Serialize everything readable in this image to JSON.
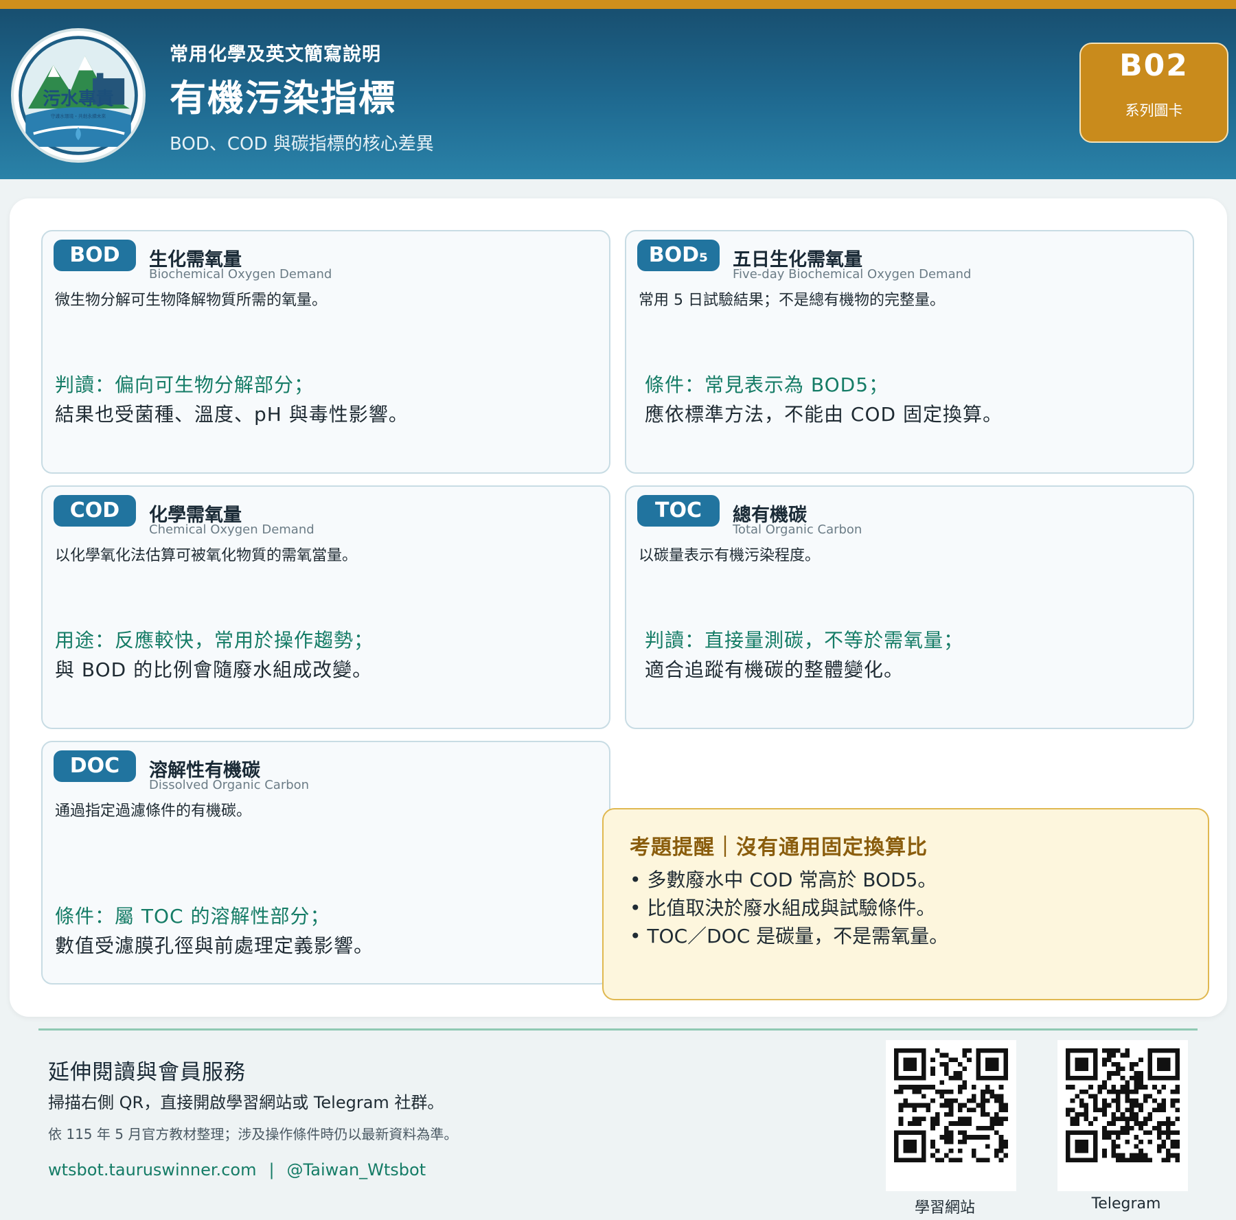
{
  "header": {
    "logo_text": "污水專責",
    "logo_motto": "守護水環境・共創永續未來",
    "kicker": "常用化學及英文簡寫說明",
    "title": "有機污染指標",
    "subtitle": "BOD、COD 與碳指標的核心差異",
    "badge_code": "B02",
    "badge_label": "系列圖卡"
  },
  "cards": [
    {
      "abbr": "BOD",
      "cn": "生化需氧量",
      "en": "Biochemical Oxygen Demand",
      "desc": "微生物分解可生物降解物質所需的氧量。",
      "line1": "判讀：偏向可生物分解部分；",
      "line2": "結果也受菌種、溫度、pH 與毒性影響。"
    },
    {
      "abbr": "BOD₅",
      "cn": "五日生化需氧量",
      "en": "Five-day Biochemical Oxygen Demand",
      "desc": "常用 5 日試驗結果；不是總有機物的完整量。",
      "line1": "條件：常見表示為 BOD5；",
      "line2": "應依標準方法，不能由 COD 固定換算。"
    },
    {
      "abbr": "COD",
      "cn": "化學需氧量",
      "en": "Chemical Oxygen Demand",
      "desc": "以化學氧化法估算可被氧化物質的需氧當量。",
      "line1": "用途：反應較快，常用於操作趨勢；",
      "line2": "與 BOD 的比例會隨廢水組成改變。"
    },
    {
      "abbr": "TOC",
      "cn": "總有機碳",
      "en": "Total Organic Carbon",
      "desc": "以碳量表示有機污染程度。",
      "line1": "判讀：直接量測碳，不等於需氧量；",
      "line2": "適合追蹤有機碳的整體變化。"
    },
    {
      "abbr": "DOC",
      "cn": "溶解性有機碳",
      "en": "Dissolved Organic Carbon",
      "desc": "通過指定過濾條件的有機碳。",
      "line1": "條件：屬 TOC 的溶解性部分；",
      "line2": "數值受濾膜孔徑與前處理定義影響。"
    }
  ],
  "tip": {
    "title": "考題提醒｜沒有通用固定換算比",
    "items": [
      "多數廢水中 COD 常高於 BOD5。",
      "比值取決於廢水組成與試驗條件。",
      "TOC／DOC 是碳量，不是需氧量。"
    ]
  },
  "footer": {
    "title": "延伸閱讀與會員服務",
    "text": "掃描右側 QR，直接開啟學習網站或 Telegram 社群。",
    "note": "依 115 年 5 月官方教材整理；涉及操作條件時仍以最新資料為準。",
    "website": "wtsbot.tauruswinner.com",
    "separator": "|",
    "telegram": "@Taiwan_Wtsbot",
    "qr_labels": [
      "學習網站",
      "Telegram"
    ]
  },
  "colors": {
    "accent_gold": "#c98b1c",
    "header_blue": "#1f6a91",
    "abbr_blue": "#21749f",
    "green_text": "#157c66",
    "tip_brown": "#8a5d0d"
  }
}
